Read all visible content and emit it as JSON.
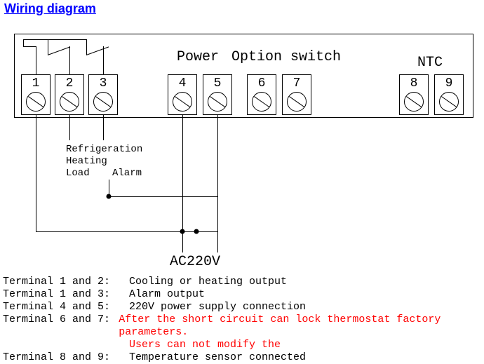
{
  "title": "Wiring diagram",
  "sections": {
    "power": "Power",
    "option": "Option switch",
    "ntc": "NTC"
  },
  "terminals": {
    "t1": "1",
    "t2": "2",
    "t3": "3",
    "t4": "4",
    "t5": "5",
    "t6": "6",
    "t7": "7",
    "t8": "8",
    "t9": "9"
  },
  "notes": {
    "line1": "Refrigeration",
    "line2": "Heating",
    "line3": "Load",
    "alarm": "Alarm",
    "ac": "AC220V"
  },
  "legend": {
    "r1l": "Terminal 1 and 2:",
    "r1r": "Cooling or heating output",
    "r2l": "Terminal 1 and 3:",
    "r2r": "Alarm output",
    "r3l": "Terminal 4 and 5:",
    "r3r": "220V power supply connection",
    "r4l": "Terminal 6 and 7:",
    "r4r": "After the short circuit can lock thermostat factory parameters.",
    "r5l": "",
    "r5r": "Users can not modify the",
    "r6l": "Terminal 8 and 9:",
    "r6r": "Temperature sensor connected"
  }
}
